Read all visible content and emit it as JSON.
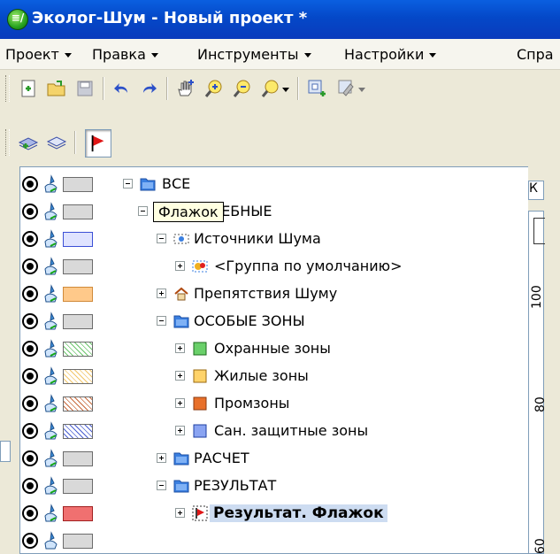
{
  "window": {
    "title": "Эколог-Шум - Новый проект *",
    "app_icon_glyph": "≡/"
  },
  "menubar": {
    "items": [
      {
        "label": "Проект"
      },
      {
        "label": "Правка"
      },
      {
        "label": "Инструменты"
      },
      {
        "label": "Настройки"
      },
      {
        "label": "Спра"
      }
    ]
  },
  "toolbar1": {
    "icons": [
      "new-document-icon",
      "open-folder-icon",
      "save-icon",
      "undo-icon",
      "redo-icon",
      "pan-hand-icon",
      "zoom-in-icon",
      "zoom-out-icon",
      "zoom-dropdown-icon",
      "layer-add-icon",
      "layer-edit-icon"
    ]
  },
  "toolbar2": {
    "icons": [
      "add-layer-group-icon",
      "layer-group-icon",
      "flag-icon"
    ],
    "pressed": "flag-icon"
  },
  "tooltip": {
    "text": "Флажок"
  },
  "right_panel": {
    "tab_label": "К",
    "tick_labels": [
      "100",
      "80",
      "60"
    ]
  },
  "tree": {
    "rows": [
      {
        "label": "ВСЕ",
        "level": 0,
        "expander": "minus",
        "icon": "folder-icon",
        "swatch": "#d9d9d9",
        "swatch_pattern": "none"
      },
      {
        "label": "СЛУЖЕБНЫЕ",
        "level": 1,
        "expander": "minus",
        "icon": "folder-icon",
        "swatch": "#d9d9d9",
        "swatch_pattern": "none"
      },
      {
        "label": "Источники Шума",
        "level": 2,
        "expander": "minus",
        "icon": "noise-source-icon",
        "swatch": "#dfe3ff",
        "swatch_pattern": "none",
        "swatch_border": "#3b4fd6"
      },
      {
        "label": "<Группа по умолчанию>",
        "level": 3,
        "expander": "plus",
        "icon": "source-group-icon",
        "swatch": "#d9d9d9",
        "swatch_pattern": "none"
      },
      {
        "label": "Препятствия Шуму",
        "level": 2,
        "expander": "plus",
        "icon": "house-icon",
        "swatch": "#ffc98a",
        "swatch_pattern": "none"
      },
      {
        "label": "ОСОБЫЕ ЗОНЫ",
        "level": 2,
        "expander": "minus",
        "icon": "folder-icon",
        "swatch": "#d9d9d9",
        "swatch_pattern": "none"
      },
      {
        "label": "Охранные зоны",
        "level": 3,
        "expander": "plus",
        "icon": "green-zone-icon",
        "swatch": "#ffffff",
        "swatch_pattern": "hatch",
        "hatch_color": "#6cc46c"
      },
      {
        "label": "Жилые зоны",
        "level": 3,
        "expander": "plus",
        "icon": "yellow-zone-icon",
        "swatch": "#ffffff",
        "swatch_pattern": "hatch",
        "hatch_color": "#f2c66a"
      },
      {
        "label": "Промзоны",
        "level": 3,
        "expander": "plus",
        "icon": "orange-zone-icon",
        "swatch": "#ffffff",
        "swatch_pattern": "hatch",
        "hatch_color": "#c86a3c"
      },
      {
        "label": "Сан. защитные зоны",
        "level": 3,
        "expander": "plus",
        "icon": "blue-zone-icon",
        "swatch": "#ffffff",
        "swatch_pattern": "hatch",
        "hatch_color": "#4a5fd1"
      },
      {
        "label": "РАСЧЕТ",
        "level": 2,
        "expander": "plus",
        "icon": "folder-icon",
        "swatch": "#d9d9d9",
        "swatch_pattern": "none"
      },
      {
        "label": "РЕЗУЛЬТАТ",
        "level": 2,
        "expander": "minus",
        "icon": "folder-icon",
        "swatch": "#d9d9d9",
        "swatch_pattern": "none"
      },
      {
        "label": "Результат. Флажок",
        "level": 3,
        "expander": "plus",
        "icon": "flag-icon",
        "swatch": "#f07070",
        "swatch_pattern": "none",
        "selected": true
      },
      {
        "label": "",
        "level": 3,
        "expander": "none",
        "icon": "none",
        "swatch": "#d9d9d9",
        "swatch_pattern": "none"
      }
    ]
  },
  "colors": {
    "titlebar": "#0a52d8",
    "selection": "#cddcf1",
    "tree_border": "#7f9db9"
  }
}
